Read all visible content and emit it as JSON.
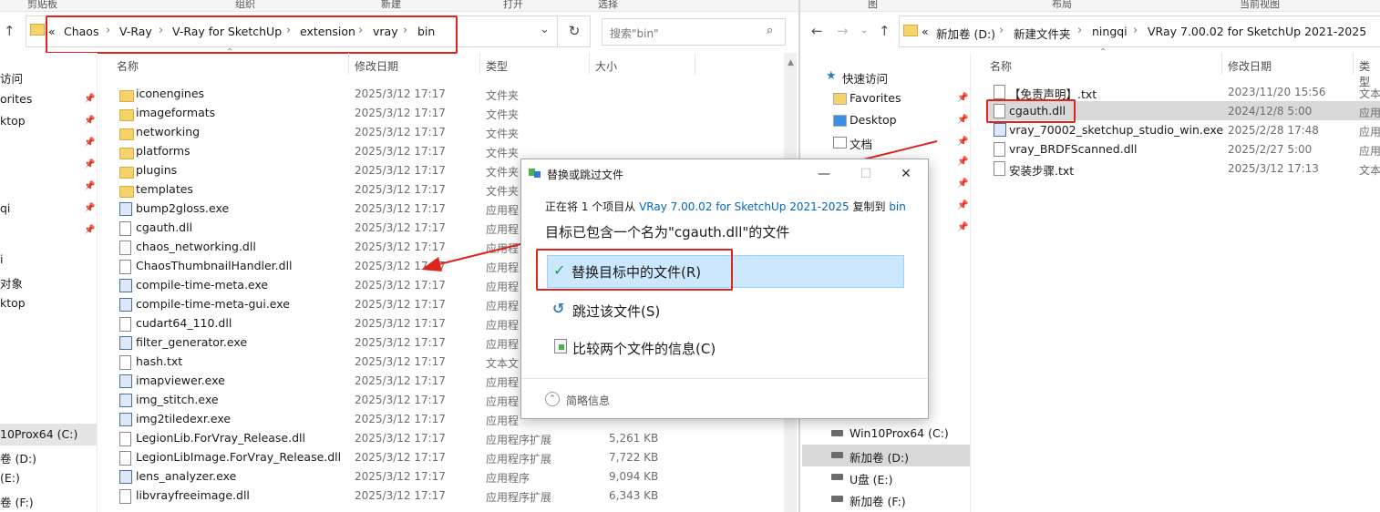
{
  "left_window": {
    "ribbon": [
      "剪贴板",
      "组织",
      "新建",
      "打开",
      "选择"
    ],
    "breadcrumb": [
      "Chaos",
      "V-Ray",
      "V-Ray for SketchUp",
      "extension",
      "vray",
      "bin"
    ],
    "breadcrumb_prefix": "«",
    "search_placeholder": "搜索\"bin\"",
    "columns": {
      "name": "名称",
      "date": "修改日期",
      "type": "类型",
      "size": "大小"
    },
    "nav": [
      {
        "label": "访问",
        "pin": false
      },
      {
        "label": "orites",
        "pin": true
      },
      {
        "label": "ktop",
        "pin": true
      },
      {
        "label": "",
        "pin": true
      },
      {
        "label": "",
        "pin": true
      },
      {
        "label": "",
        "pin": true
      },
      {
        "label": "qi",
        "pin": true
      },
      {
        "label": "",
        "pin": true
      },
      {
        "label": "i",
        "pin": false
      },
      {
        "label": "对象",
        "pin": false
      },
      {
        "label": "ktop",
        "pin": false
      },
      {
        "label": "10Prox64 (C:)",
        "pin": false,
        "selected": true
      },
      {
        "label": "卷 (D:)",
        "pin": false
      },
      {
        "label": "(E:)",
        "pin": false
      },
      {
        "label": "卷 (F:)",
        "pin": false
      }
    ],
    "files": [
      {
        "name": "iconengines",
        "date": "2025/3/12 17:17",
        "type": "文件夹",
        "size": "",
        "icon": "folder"
      },
      {
        "name": "imageformats",
        "date": "2025/3/12 17:17",
        "type": "文件夹",
        "size": "",
        "icon": "folder"
      },
      {
        "name": "networking",
        "date": "2025/3/12 17:17",
        "type": "文件夹",
        "size": "",
        "icon": "folder"
      },
      {
        "name": "platforms",
        "date": "2025/3/12 17:17",
        "type": "文件夹",
        "size": "",
        "icon": "folder"
      },
      {
        "name": "plugins",
        "date": "2025/3/12 17:17",
        "type": "文件夹",
        "size": "",
        "icon": "folder"
      },
      {
        "name": "templates",
        "date": "2025/3/12 17:17",
        "type": "文件夹",
        "size": "",
        "icon": "folder"
      },
      {
        "name": "bump2gloss.exe",
        "date": "2025/3/12 17:17",
        "type": "应用程",
        "size": "",
        "icon": "exe"
      },
      {
        "name": "cgauth.dll",
        "date": "2025/3/12 17:17",
        "type": "应用程",
        "size": "",
        "icon": "file"
      },
      {
        "name": "chaos_networking.dll",
        "date": "2025/3/12 17:17",
        "type": "应用程",
        "size": "",
        "icon": "file"
      },
      {
        "name": "ChaosThumbnailHandler.dll",
        "date": "2025/3/12 17:17",
        "type": "应用程",
        "size": "",
        "icon": "file"
      },
      {
        "name": "compile-time-meta.exe",
        "date": "2025/3/12 17:17",
        "type": "应用程",
        "size": "",
        "icon": "exe"
      },
      {
        "name": "compile-time-meta-gui.exe",
        "date": "2025/3/12 17:17",
        "type": "应用程",
        "size": "",
        "icon": "exe"
      },
      {
        "name": "cudart64_110.dll",
        "date": "2025/3/12 17:17",
        "type": "应用程",
        "size": "",
        "icon": "file"
      },
      {
        "name": "filter_generator.exe",
        "date": "2025/3/12 17:17",
        "type": "应用程",
        "size": "",
        "icon": "exe"
      },
      {
        "name": "hash.txt",
        "date": "2025/3/12 17:17",
        "type": "文本文",
        "size": "",
        "icon": "file"
      },
      {
        "name": "imapviewer.exe",
        "date": "2025/3/12 17:17",
        "type": "应用程",
        "size": "",
        "icon": "exe"
      },
      {
        "name": "img_stitch.exe",
        "date": "2025/3/12 17:17",
        "type": "应用程",
        "size": "",
        "icon": "exe"
      },
      {
        "name": "img2tiledexr.exe",
        "date": "2025/3/12 17:17",
        "type": "应用程",
        "size": "",
        "icon": "exe"
      },
      {
        "name": "LegionLib.ForVray_Release.dll",
        "date": "2025/3/12 17:17",
        "type": "应用程序扩展",
        "size": "5,261 KB",
        "icon": "file"
      },
      {
        "name": "LegionLibImage.ForVray_Release.dll",
        "date": "2025/3/12 17:17",
        "type": "应用程序扩展",
        "size": "7,722 KB",
        "icon": "file"
      },
      {
        "name": "lens_analyzer.exe",
        "date": "2025/3/12 17:17",
        "type": "应用程序",
        "size": "9,094 KB",
        "icon": "exe"
      },
      {
        "name": "libvrayfreeimage.dll",
        "date": "2025/3/12 17:17",
        "type": "应用程序扩展",
        "size": "6,343 KB",
        "icon": "file"
      }
    ]
  },
  "right_window": {
    "ribbon": [
      "图",
      "布局",
      "当前视图"
    ],
    "breadcrumb": [
      "新加卷 (D:)",
      "新建文件夹",
      "ningqi",
      "VRay 7.00.02 for SketchUp 2021-2025"
    ],
    "breadcrumb_prefix": "«",
    "columns": {
      "name": "名称",
      "date": "修改日期",
      "type": "类型"
    },
    "nav_top": [
      {
        "label": "快速访问",
        "pin": false
      },
      {
        "label": "Favorites",
        "pin": true
      },
      {
        "label": "Desktop",
        "pin": true
      },
      {
        "label": "文档",
        "pin": true
      }
    ],
    "nav_bottom": [
      {
        "label": "Win10Prox64 (C:)",
        "selected": false
      },
      {
        "label": "新加卷 (D:)",
        "selected": true
      },
      {
        "label": "U盘 (E:)",
        "selected": false
      },
      {
        "label": "新加卷 (F:)",
        "selected": false
      }
    ],
    "files": [
      {
        "name": "【免责声明】.txt",
        "date": "2023/11/20 15:56",
        "type": "文本",
        "icon": "file"
      },
      {
        "name": "cgauth.dll",
        "date": "2024/12/8 5:00",
        "type": "应用",
        "icon": "file"
      },
      {
        "name": "vray_70002_sketchup_studio_win.exe",
        "date": "2025/2/28 17:48",
        "type": "应用",
        "icon": "exe"
      },
      {
        "name": "vray_BRDFScanned.dll",
        "date": "2025/2/27 5:00",
        "type": "应用",
        "icon": "file"
      },
      {
        "name": "安装步骤.txt",
        "date": "2025/3/12 17:13",
        "type": "文本",
        "icon": "file"
      }
    ]
  },
  "dialog": {
    "title": "替换或跳过文件",
    "info_prefix": "正在将 1 个项目从",
    "info_source": "VRay 7.00.02 for SketchUp 2021-2025",
    "info_mid": "复制到",
    "info_dest": "bin",
    "heading": "目标已包含一个名为\"cgauth.dll\"的文件",
    "option_replace": "替换目标中的文件(R)",
    "option_skip": "跳过该文件(S)",
    "option_compare": "比较两个文件的信息(C)",
    "details": "简略信息",
    "close_symbol": "✕",
    "min_symbol": "—",
    "max_symbol": "☐"
  },
  "colors": {
    "highlight_red": "#e0241b",
    "selection_blue": "#cce8ff",
    "link_blue": "#0067c0"
  }
}
